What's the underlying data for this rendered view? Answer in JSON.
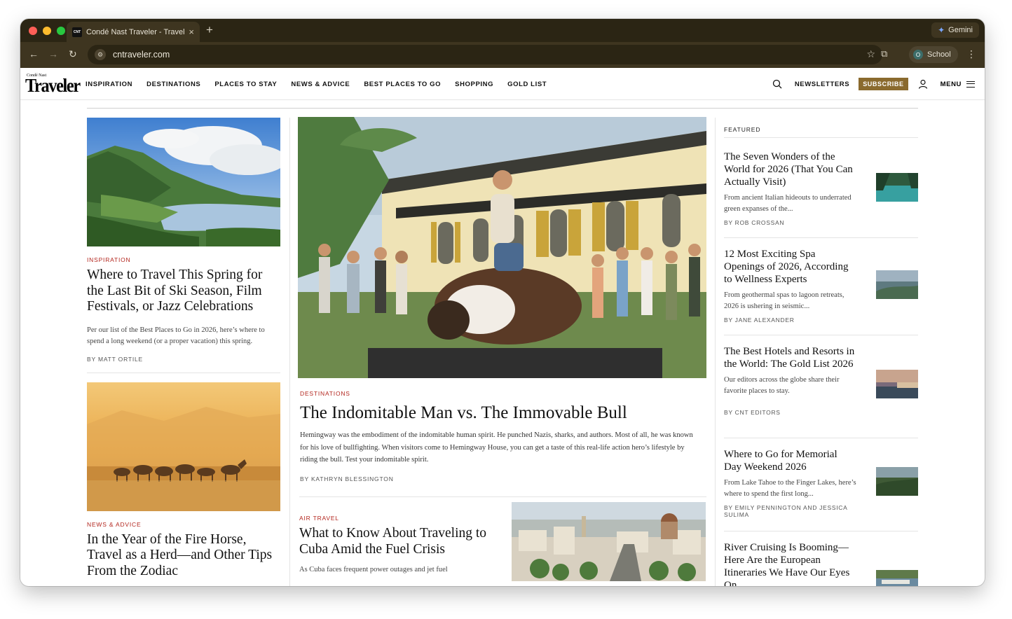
{
  "browser": {
    "tab_title": "Condé Nast Traveler - Travel",
    "tab_favicon": "CNT",
    "tab_close": "×",
    "new_tab": "+",
    "gemini_label": "Gemini",
    "url": "cntraveler.com",
    "profile_initial": "O",
    "profile_name": "School",
    "icons": [
      "back-arrow-icon",
      "forward-arrow-icon",
      "reload-icon",
      "site-info-icon",
      "bookmark-star-icon",
      "tab-search-icon",
      "more-vert-icon"
    ]
  },
  "site": {
    "logo_small": "Condé Nast",
    "logo_big": "Traveler",
    "nav": [
      "INSPIRATION",
      "DESTINATIONS",
      "PLACES TO STAY",
      "NEWS & ADVICE",
      "BEST PLACES TO GO",
      "SHOPPING",
      "GOLD LIST"
    ],
    "newsletters": "NEWSLETTERS",
    "subscribe": "SUBSCRIBE",
    "menu": "MENU",
    "brand_color": "#8a6a2e",
    "kicker_color": "#b3261e"
  },
  "left": [
    {
      "kicker": "INSPIRATION",
      "title": "Where to Travel This Spring for the Last Bit of Ski Season, Film Festivals, or Jazz Celebrations",
      "dek": "Per our list of the Best Places to Go in 2026, here’s where to spend a long weekend (or a proper vacation) this spring.",
      "byline": "BY MATT ORTILE"
    },
    {
      "kicker": "NEWS & ADVICE",
      "title": "In the Year of the Fire Horse, Travel as a Herd—and Other Tips From the Zodiac"
    }
  ],
  "center": {
    "kicker": "DESTINATIONS",
    "title": "The Indomitable Man vs. The Immovable Bull",
    "dek": "Hemingway was the embodiment of the indomitable human spirit. He punched Nazis, sharks, and authors. Most of all, he was known for his love of bullfighting. When visitors come to Hemingway House, you can get a taste of this real-life action hero’s lifestyle by riding the bull. Test your indomitable spirit.",
    "byline": "BY KATHRYN BLESSINGTON",
    "secondary": {
      "kicker": "AIR TRAVEL",
      "title": "What to Know About Traveling to Cuba Amid the Fuel Crisis",
      "dek": "As Cuba faces frequent power outages and jet fuel"
    }
  },
  "featured": {
    "heading": "FEATURED",
    "items": [
      {
        "title": "The Seven Wonders of the World for 2026 (That You Can Actually Visit)",
        "dek": "From ancient Italian hideouts to underrated green expanses of the...",
        "byline": "BY ROB CROSSAN"
      },
      {
        "title": "12 Most Exciting Spa Openings of 2026, According to Wellness Experts",
        "dek": "From geothermal spas to lagoon retreats, 2026 is ushering in seismic...",
        "byline": "BY JANE ALEXANDER"
      },
      {
        "title": "The Best Hotels and Resorts in the World: The Gold List 2026",
        "dek": "Our editors across the globe share their favorite places to stay.",
        "byline": "BY CNT EDITORS"
      },
      {
        "title": "Where to Go for Memorial Day Weekend 2026",
        "dek": "From Lake Tahoe to the Finger Lakes, here’s where to spend the first long...",
        "byline": "BY EMILY PENNINGTON AND JESSICA SULIMA"
      },
      {
        "title": "River Cruising Is Booming—Here Are the European Itineraries We Have Our Eyes On"
      }
    ]
  }
}
